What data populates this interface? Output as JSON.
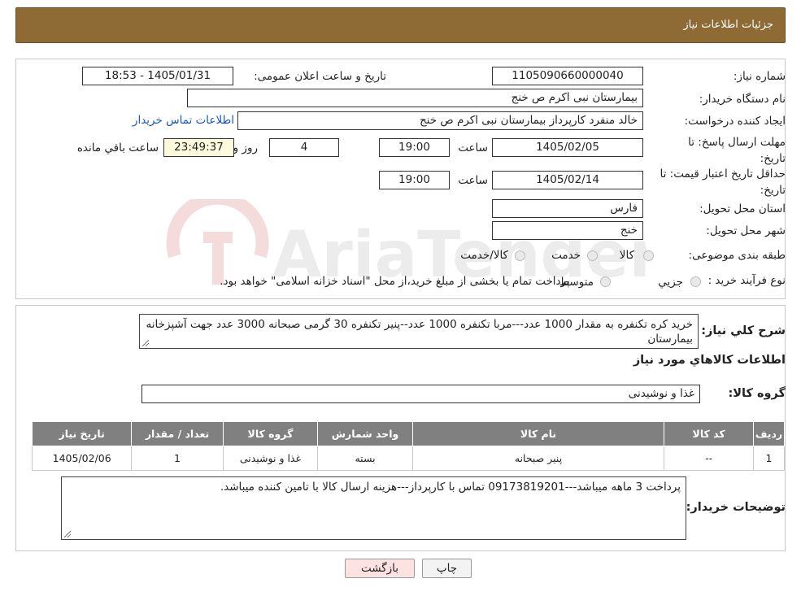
{
  "header": {
    "title": "جزئیات اطلاعات نیاز"
  },
  "form": {
    "need_number_label": "شماره نیاز:",
    "need_number": "1105090660000040",
    "announce_label": "تاریخ و ساعت اعلان عمومی:",
    "announce_value": "1405/01/31 - 18:53",
    "buyer_org_label": "نام دستگاه خریدار:",
    "buyer_org": "بیمارستان نبی اکرم  ص  خنج",
    "creator_label": "ایجاد کننده درخواست:",
    "creator": "خالد منفرد کارپرداز بیمارستان نبی اکرم  ص  خنج",
    "contact_link": "اطلاعات تماس خریدار",
    "reply_deadline_label_1": "مهلت ارسال پاسخ: تا",
    "reply_deadline_label_2": "تاریخ:",
    "reply_date": "1405/02/05",
    "time_label": "ساعت",
    "reply_time": "19:00",
    "days": "4",
    "days_label": "روز و",
    "remaining_time": "23:49:37",
    "remaining_label": "ساعت باقي مانده",
    "price_validity_label_1": "حداقل تاریخ اعتبار قیمت: تا",
    "price_validity_label_2": "تاریخ:",
    "price_validity_date": "1405/02/14",
    "price_validity_time": "19:00",
    "province_label": "استان محل تحویل:",
    "province": "فارس",
    "city_label": "شهر محل تحویل:",
    "city": "خنج",
    "category_label": "طبقه بندی موضوعی:",
    "category_options": [
      "کالا",
      "خدمت",
      "کالا/خدمت"
    ],
    "process_label": "نوع فرآیند خرید :",
    "process_options": [
      "جزيي",
      "متوسط"
    ],
    "process_note": "پرداخت تمام یا بخشی از مبلغ خرید،از محل \"اسناد خزانه اسلامی\" خواهد بود."
  },
  "details": {
    "description_label": "شرح کلي نياز:",
    "description": "خرید کره تکنفره به مقدار 1000 عدد---مربا تکنفره 1000 عدد--پنیر تکنفره 30 گرمی صبحانه 3000 عدد جهت آشپزخانه بیمارستان",
    "goods_info_title": "اطلاعات کالاهاي مورد نياز",
    "goods_group_label": "گروه کالا:",
    "goods_group": "غذا و نوشیدنی",
    "table": {
      "headers": [
        "رديف",
        "کد کالا",
        "نام کالا",
        "واحد شمارش",
        "گروه کالا",
        "تعداد / مقدار",
        "تاريخ نياز"
      ],
      "rows": [
        [
          "1",
          "--",
          "پنیر صبحانه",
          "بسته",
          "غذا و نوشیدنی",
          "1",
          "1405/02/06"
        ]
      ]
    },
    "buyer_notes_label": "توضیحات خریدار:",
    "buyer_notes": "پرداخت 3 ماهه میباشد---09173819201 تماس با کارپرداز---هزینه ارسال کالا با تامین کننده میباشد."
  },
  "buttons": {
    "print": "چاپ",
    "back": "بازگشت"
  },
  "watermark_text": "AriaTender.neT",
  "colors": {
    "header_bg": "#8e6a35",
    "back_button_bg": "#fde2e2",
    "link": "#1a56c4",
    "timer_bg": "#fdfbdc"
  }
}
